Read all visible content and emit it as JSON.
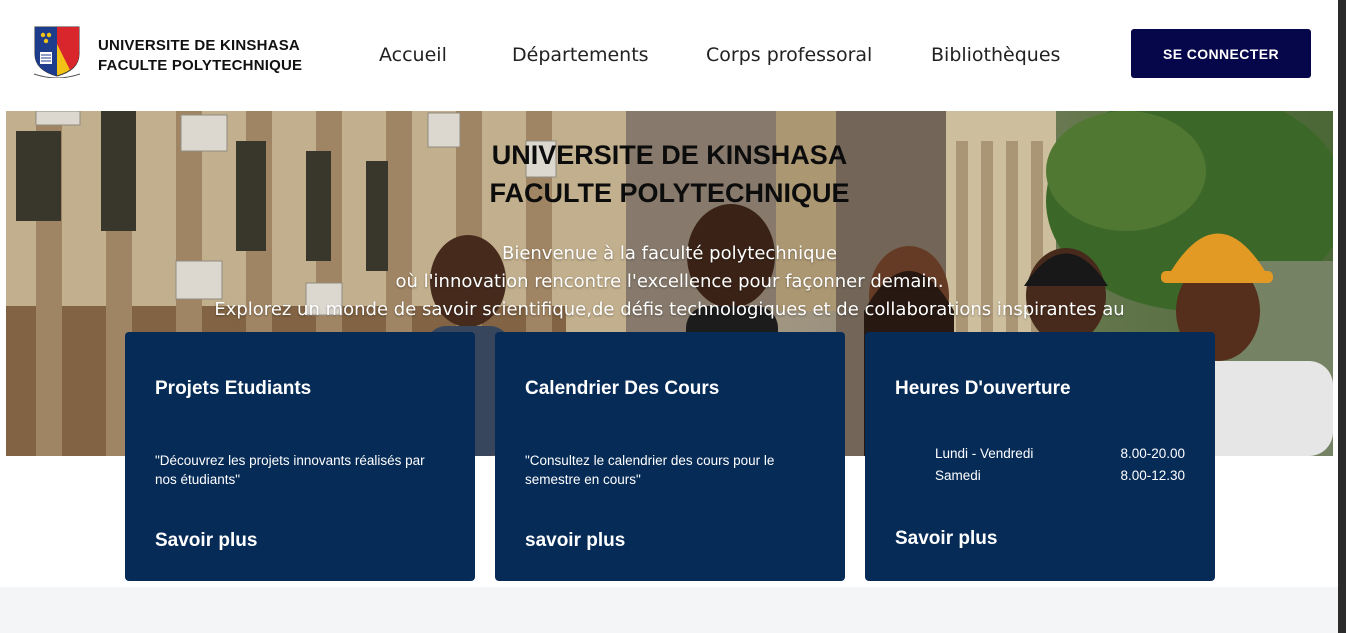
{
  "header": {
    "brand_line1": "UNIVERSITE DE KINSHASA",
    "brand_line2": "FACULTE POLYTECHNIQUE",
    "nav": [
      "Accueil",
      "Départements",
      "Corps professoral",
      "Bibliothèques"
    ],
    "login_label": "SE CONNECTER"
  },
  "hero": {
    "title_line1": "UNIVERSITE DE KINSHASA",
    "title_line2": "FACULTE POLYTECHNIQUE",
    "sub_line1": "Bienvenue à la faculté polytechnique",
    "sub_line2": "où l'innovation rencontre l'excellence pour façonner demain.",
    "sub_line3": "Explorez un monde de savoir scientifique,de défis technologiques et de collaborations inspirantes au"
  },
  "cards": [
    {
      "title": "Projets Etudiants",
      "text": "\"Découvrez les projets innovants réalisés par nos étudiants\"",
      "link": "Savoir plus"
    },
    {
      "title": "Calendrier Des Cours",
      "text": "\"Consultez le calendrier des cours pour le semestre en cours\"",
      "link": "savoir plus"
    },
    {
      "title": "Heures D'ouverture",
      "hours": [
        {
          "day": "Lundi - Vendredi",
          "time": "8.00-20.00"
        },
        {
          "day": "Samedi",
          "time": "8.00-12.30"
        }
      ],
      "link": "Savoir plus"
    }
  ],
  "colors": {
    "card_bg": "#062b57",
    "button_bg": "#06064a"
  }
}
